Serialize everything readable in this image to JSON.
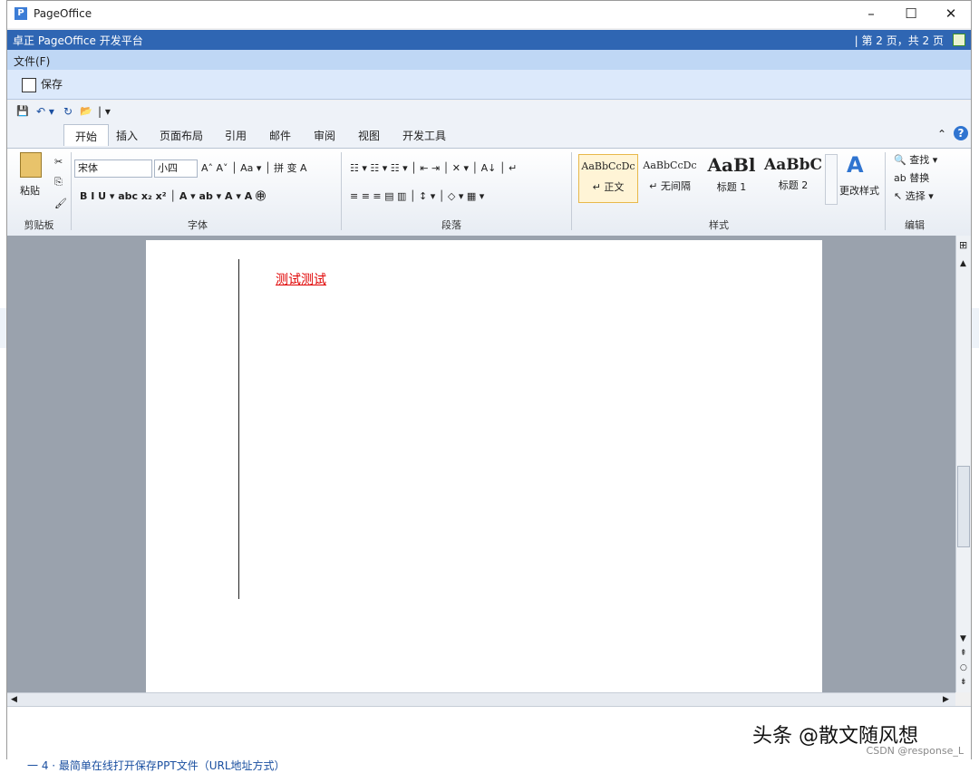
{
  "window": {
    "title": "PageOffice",
    "minimize": "–",
    "maximize": "☐",
    "close": "✕"
  },
  "po_header": {
    "title": "卓正 PageOffice 开发平台",
    "page_info": "| 第 2 页，共 2 页"
  },
  "menubar": {
    "file": "文件(F)"
  },
  "po_toolbar": {
    "save": "保存"
  },
  "qat": {
    "save": "💾",
    "undo": "↶ ▾",
    "redo": "↻",
    "open": "📂",
    "customize": "| ▾"
  },
  "tabs": [
    "开始",
    "插入",
    "页面布局",
    "引用",
    "邮件",
    "审阅",
    "视图",
    "开发工具"
  ],
  "ribbon": {
    "clipboard": {
      "paste": "粘贴",
      "label": "剪贴板"
    },
    "font": {
      "name": "宋体",
      "size": "小四",
      "label": "字体",
      "row1": "A˄ A˅ │ Aa ▾ │ 拼 变 A",
      "row2": "B  I  U ▾ abc x₂ x² │ A ▾ ab ▾ A ▾ A ㊥"
    },
    "paragraph": {
      "label": "段落",
      "row1": "☷ ▾ ☷ ▾ ☷ ▾ │ ⇤ ⇥ │ ✕ ▾ │ A↓ │ ↵",
      "row2": "≡ ≡ ≡ ▤ ▥ │ ↕ ▾ │ ◇ ▾ ▦ ▾"
    },
    "styles": {
      "label": "样式",
      "items": [
        {
          "preview": "AaBbCcDc",
          "name": "↵ 正文"
        },
        {
          "preview": "AaBbCcDc",
          "name": "↵ 无间隔"
        },
        {
          "preview": "AaBl",
          "name": "标题 1"
        },
        {
          "preview": "AaBbC",
          "name": "标题 2"
        }
      ],
      "change": "更改样式"
    },
    "editing": {
      "label": "编辑",
      "find": "查找 ▾",
      "replace": "替换",
      "select": "选择 ▾"
    }
  },
  "document": {
    "text": "测试测试"
  },
  "watermark": {
    "text": "头条 @散文随风想",
    "csdn": "CSDN @response_L"
  },
  "below_window": {
    "text": "一  4 · 最简单在线打开保存PPT文件（URL地址方式）"
  }
}
